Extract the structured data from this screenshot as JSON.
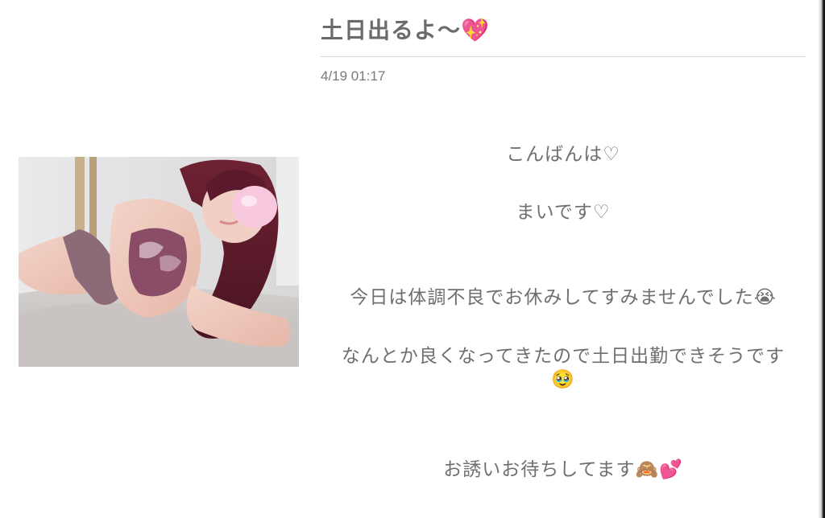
{
  "post": {
    "title": "土日出るよ〜💖",
    "date": "4/19 01:17",
    "photo_icon": "photo-image",
    "body_lines": [
      "こんばんは♡",
      "まいです♡",
      "今日は体調不良でお休みしてすみませんでした😭",
      "なんとか良くなってきたので土日出勤できそうです",
      "🥹",
      "お誘いお待ちしてます🙈💕"
    ]
  },
  "colors": {
    "text": "#6f6f6f",
    "divider": "#d6d6d6",
    "background": "#ffffff"
  }
}
